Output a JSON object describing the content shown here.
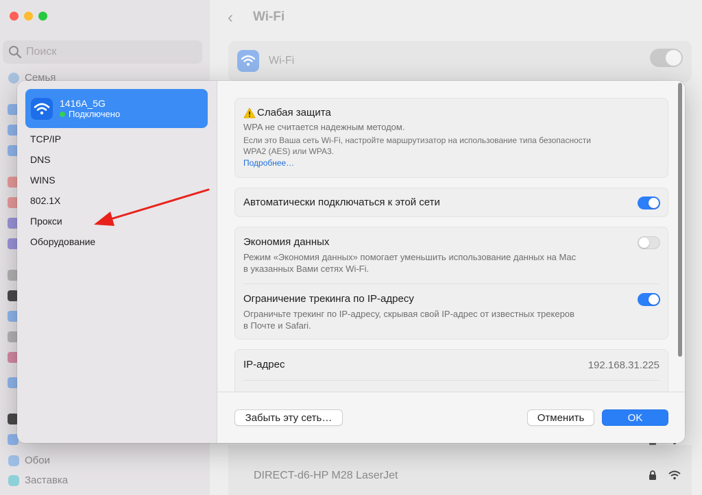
{
  "background": {
    "search_placeholder": "Поиск",
    "sidebar_items": [
      "Семья",
      "Обои",
      "Заставка"
    ],
    "back_glyph": "‹",
    "title": "Wi-Fi",
    "wifi_label": "Wi-Fi",
    "networks": [
      "DIRECT-d6-HP M28 LaserJet"
    ]
  },
  "dialog": {
    "network": {
      "name": "1416A_5G",
      "status": "Подключено"
    },
    "sidebar_items": [
      "TCP/IP",
      "DNS",
      "WINS",
      "802.1X",
      "Прокси",
      "Оборудование"
    ],
    "warning": {
      "title": "Слабая защита",
      "line1": "WPA не считается надежным методом.",
      "line2": "Если это Ваша сеть Wi-Fi, настройте маршрутизатор на использование типа безопасности",
      "line3": "WPA2 (AES) или WPA3.",
      "link": "Подробнее…"
    },
    "auto_join": {
      "label": "Автоматически подключаться к этой сети",
      "enabled": true
    },
    "low_data": {
      "label": "Экономия данных",
      "desc1": "Режим «Экономия данных» помогает уменьшить использование данных на Mac",
      "desc2": "в указанных Вами сетях Wi-Fi.",
      "enabled": false
    },
    "limit_tracking": {
      "label": "Ограничение трекинга по IP-адресу",
      "desc1": "Ограничьте трекинг по IP-адресу, скрывая свой IP-адрес от известных трекеров",
      "desc2": "в Почте и Safari.",
      "enabled": true
    },
    "ip": {
      "label": "IP-адрес",
      "value": "192.168.31.225"
    },
    "buttons": {
      "forget": "Забыть эту сеть…",
      "cancel": "Отменить",
      "ok": "OK"
    }
  },
  "colors": {
    "accent": "#2a7ff7",
    "annotation_arrow": "#e8221b",
    "connected_dot": "#33d154",
    "warning": "#f5c400"
  }
}
